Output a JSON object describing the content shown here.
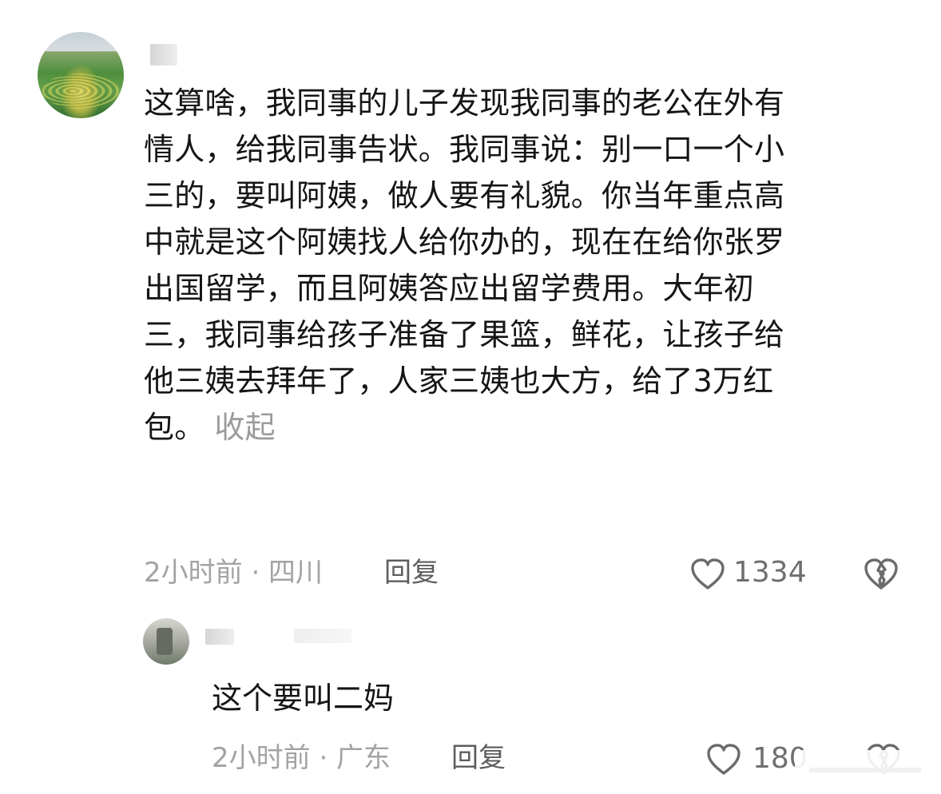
{
  "comment_main": {
    "author_name": "user",
    "text_lines": [
      "这算啥，我同事的儿子发现我同事的老公在外有",
      "情人，给我同事告状。我同事说：别一口一个小",
      "三的，要叫阿姨，做人要有礼貌。你当年重点高",
      "中就是这个阿姨找人给你办的，现在在给你张罗",
      "出国留学，而且阿姨答应出留学费用。大年初",
      "三，我同事给孩子准备了果篮，鲜花，让孩子给",
      "他三姨去拜年了，人家三姨也大方，给了3万红",
      "包。"
    ],
    "collapse_label": "收起",
    "meta": "2小时前 · 四川",
    "reply_label": "回复",
    "like_count": "1334"
  },
  "reply_comment": {
    "author_name": "user",
    "text": "这个要叫二妈",
    "meta": "2小时前 · 广东",
    "reply_label": "回复",
    "like_count": "180"
  },
  "icons": {
    "like": "heart-outline-icon",
    "dislike": "broken-heart-icon"
  },
  "colors": {
    "text": "#151515",
    "meta": "#a3a3a3",
    "reply": "#5d5d5d",
    "icon": "#6b6b6b"
  }
}
